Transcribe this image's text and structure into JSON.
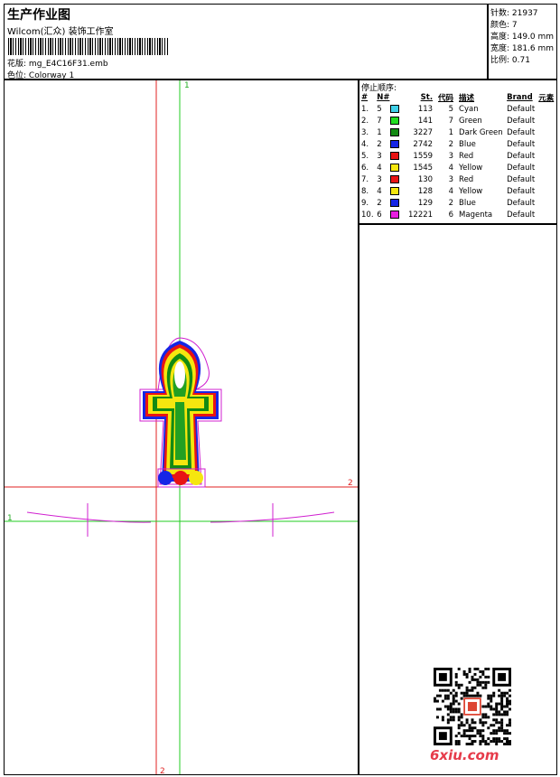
{
  "header": {
    "title": "生产作业图",
    "company": "Wilcom(汇众) 装饰工作室",
    "pattern_label": "花版:",
    "pattern": "mg_E4C16F31.emb",
    "colorway_label": "色位:",
    "colorway": "Colorway 1"
  },
  "stats": {
    "stitches": "针数: 21937",
    "colors": "颜色: 7",
    "height": "高度: 149.0 mm",
    "width": "宽度: 181.6 mm",
    "scale": "比例: 0.71"
  },
  "sequence": {
    "title": "停止顺序:",
    "headers": [
      "#",
      "N#",
      "",
      "St.",
      "代码",
      "描述",
      "Brand",
      "元素"
    ],
    "rows": [
      {
        "n": "1.",
        "nn": "5",
        "color": "#3fd0e8",
        "st": "113",
        "code": "5",
        "desc": "Cyan",
        "brand": "Default"
      },
      {
        "n": "2.",
        "nn": "7",
        "color": "#22dd22",
        "st": "141",
        "code": "7",
        "desc": "Green",
        "brand": "Default"
      },
      {
        "n": "3.",
        "nn": "1",
        "color": "#138a13",
        "st": "3227",
        "code": "1",
        "desc": "Dark Green",
        "brand": "Default"
      },
      {
        "n": "4.",
        "nn": "2",
        "color": "#1525e6",
        "st": "2742",
        "code": "2",
        "desc": "Blue",
        "brand": "Default"
      },
      {
        "n": "5.",
        "nn": "3",
        "color": "#e81414",
        "st": "1559",
        "code": "3",
        "desc": "Red",
        "brand": "Default"
      },
      {
        "n": "6.",
        "nn": "4",
        "color": "#f5e60f",
        "st": "1545",
        "code": "4",
        "desc": "Yellow",
        "brand": "Default"
      },
      {
        "n": "7.",
        "nn": "3",
        "color": "#e81414",
        "st": "130",
        "code": "3",
        "desc": "Red",
        "brand": "Default"
      },
      {
        "n": "8.",
        "nn": "4",
        "color": "#f5e60f",
        "st": "128",
        "code": "4",
        "desc": "Yellow",
        "brand": "Default"
      },
      {
        "n": "9.",
        "nn": "2",
        "color": "#1525e6",
        "st": "129",
        "code": "2",
        "desc": "Blue",
        "brand": "Default"
      },
      {
        "n": "10.",
        "nn": "6",
        "color": "#e81ee0",
        "st": "12221",
        "code": "6",
        "desc": "Magenta",
        "brand": "Default"
      }
    ]
  },
  "canvas": {
    "guide_v1_label": "1",
    "guide_v2_label": "2",
    "guide_h1_label": "1",
    "guide_h2_label": "2"
  },
  "watermark": {
    "site": "6xiu.com"
  }
}
